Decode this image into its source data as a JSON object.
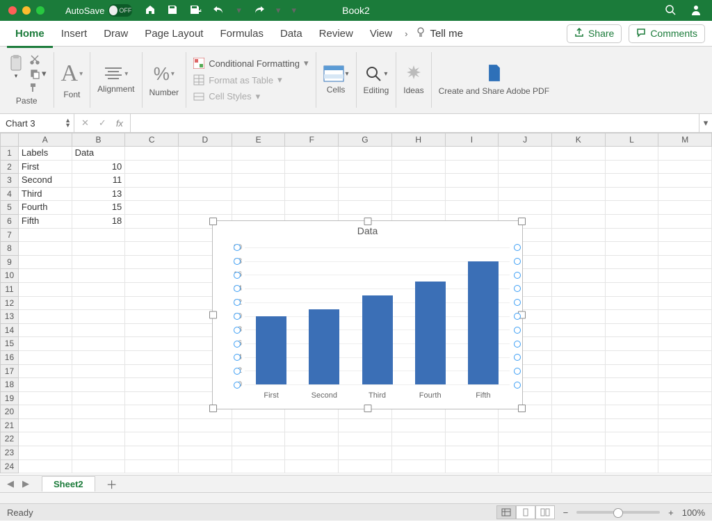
{
  "title_bar": {
    "autosave_label": "AutoSave",
    "autosave_state": "OFF",
    "doc_title": "Book2"
  },
  "tabs": [
    "Home",
    "Insert",
    "Draw",
    "Page Layout",
    "Formulas",
    "Data",
    "Review",
    "View"
  ],
  "tab_active": 0,
  "tell_me": "Tell me",
  "share": "Share",
  "comments": "Comments",
  "ribbon": {
    "paste": "Paste",
    "font": "Font",
    "alignment": "Alignment",
    "number": "Number",
    "cond_fmt": "Conditional Formatting",
    "fmt_table": "Format as Table",
    "cell_styles": "Cell Styles",
    "cells": "Cells",
    "editing": "Editing",
    "ideas": "Ideas",
    "adobe": "Create and Share Adobe PDF"
  },
  "namebox": "Chart 3",
  "fx": "fx",
  "columns": [
    "A",
    "B",
    "C",
    "D",
    "E",
    "F",
    "G",
    "H",
    "I",
    "J",
    "K",
    "L",
    "M"
  ],
  "row_count": 24,
  "cells": {
    "A1": "Labels",
    "B1": "Data",
    "A2": "First",
    "B2": "10",
    "A3": "Second",
    "B3": "11",
    "A4": "Third",
    "B4": "13",
    "A5": "Fourth",
    "B5": "15",
    "A6": "Fifth",
    "B6": "18"
  },
  "chart_data": {
    "type": "bar",
    "title": "Data",
    "categories": [
      "First",
      "Second",
      "Third",
      "Fourth",
      "Fifth"
    ],
    "values": [
      10,
      11,
      13,
      15,
      18
    ],
    "ylim": [
      0,
      20
    ],
    "ystep": 2
  },
  "sheet_tab": "Sheet2",
  "status": "Ready",
  "zoom": "100%"
}
